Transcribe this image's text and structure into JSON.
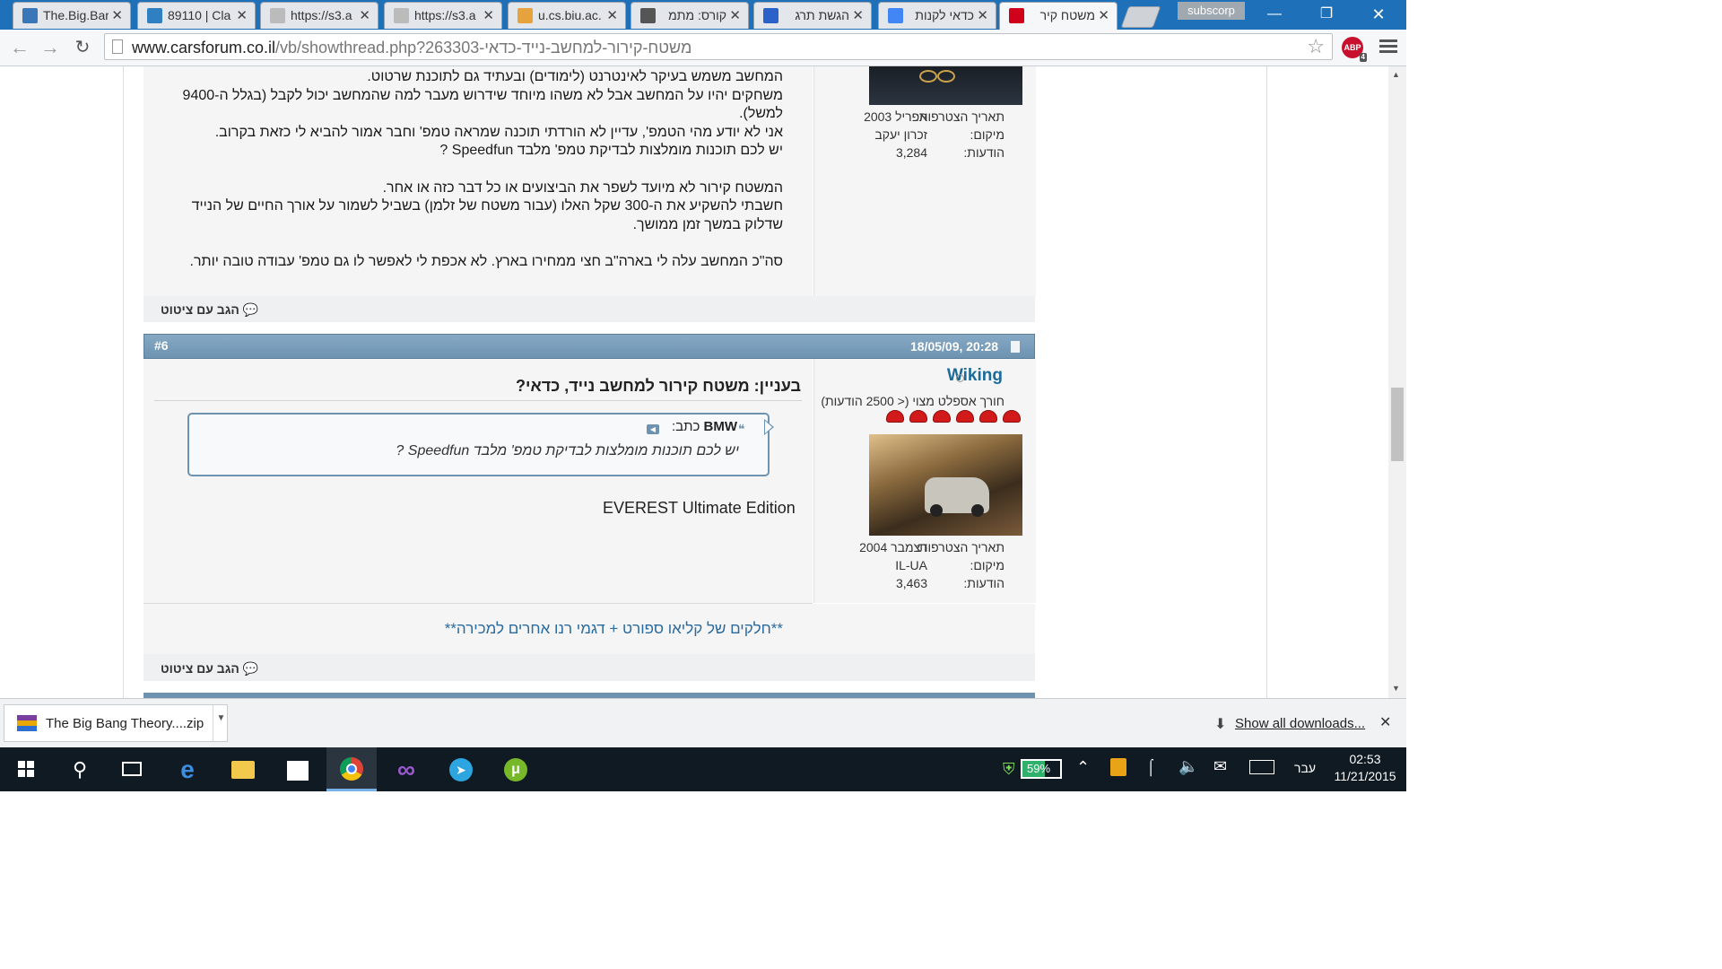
{
  "browser": {
    "tabs": [
      {
        "title": "The.Big.Bar",
        "favicon": "tz-icon",
        "color": "#3a77b8"
      },
      {
        "title": "89110 | Cla",
        "favicon": "p-icon",
        "color": "#2f7fc1"
      },
      {
        "title": "https://s3.a",
        "favicon": "page-icon",
        "color": "#bbbbbb"
      },
      {
        "title": "https://s3.a",
        "favicon": "page-icon",
        "color": "#bbbbbb"
      },
      {
        "title": "u.cs.biu.ac.",
        "favicon": "mail-icon",
        "color": "#e6a23c"
      },
      {
        "title": "קורס: מתמ",
        "favicon": "moodle-icon",
        "color": "#555555"
      },
      {
        "title": "הגשת תרג",
        "favicon": "bookmark-icon",
        "color": "#2b62c9"
      },
      {
        "title": "כדאי לקנות",
        "favicon": "google-icon",
        "color": "#4285f4"
      },
      {
        "title": "משטח קיר",
        "favicon": "car-icon",
        "color": "#d0021b",
        "active": true
      }
    ],
    "profile_label": "subscorp",
    "address": {
      "host": "www.carsforum.co.il",
      "path": "/vb/showthread.php?263303-משטח-קירור-למחשב-נייד-כדאי"
    },
    "abp_badge": "4"
  },
  "post_prev": {
    "lines": [
      "המחשב משמש בעיקר לאינטרנט (לימודים) ובעתיד גם לתוכנת שרטוט.",
      "משחקים יהיו על המחשב אבל לא משהו מיוחד שידרוש מעבר למה שהמחשב יכול לקבל (בגלל ה-9400",
      "למשל).",
      "אני לא יודע מהי הטמפ', עדיין לא הורדתי תוכנה שמראה טמפ' וחבר אמור להביא לי כזאת בקרוב.",
      "יש לכם תוכנות מומלצות לבדיקת טמפ' מלבד Speedfun ?",
      "",
      "המשטח קירור לא מיועד לשפר את הביצועים או כל דבר כזה או אחר.",
      "חשבתי להשקיע את ה-300 שקל האלו (עבור משטח של זלמן) בשביל לשמור על אורך החיים של הנייד",
      "שדלוק במשך זמן ממושך.",
      "",
      "סה\"כ המחשב עלה לי בארה\"ב חצי ממחירו בארץ. לא אכפת לי לאפשר לו גם טמפ' עבודה טובה יותר."
    ],
    "author_info": [
      {
        "label": "תאריך הצטרפות:",
        "value": "אפריל 2003"
      },
      {
        "label": "מיקום:",
        "value": "זכרון יעקב"
      },
      {
        "label": "הודעות:",
        "value": "3,284"
      }
    ],
    "reply_quote_label": "הגב עם ציטוט"
  },
  "post": {
    "number": "#6",
    "datetime": "18/05/09, 20:28",
    "author": "Wiking",
    "author_title": "חורך אספלט מצוי (< 2500 הודעות)",
    "reputation_count": 6,
    "title": "בעניין: משטח קירור למחשב נייד, כדאי?",
    "quote": {
      "author": "BMW",
      "wrote": "כתב:",
      "text": "יש לכם תוכנות מומלצות לבדיקת טמפ' מלבד Speedfun ?"
    },
    "body": "EVEREST Ultimate Edition",
    "signature": "**חלקים של קליאו ספורט + דגמי רנו אחרים למכירה**",
    "author_info": [
      {
        "label": "תאריך הצטרפות:",
        "value": "דצמבר 2004"
      },
      {
        "label": "מיקום:",
        "value": "IL-UA"
      },
      {
        "label": "הודעות:",
        "value": "3,463"
      }
    ],
    "reply_quote_label": "הגב עם ציטוט"
  },
  "downloads": {
    "file": "The Big Bang Theory....zip",
    "show_all": "Show all downloads..."
  },
  "taskbar": {
    "battery": "59%",
    "lang": "עבר",
    "time": "02:53",
    "date": "11/21/2015"
  },
  "colors": {
    "postbar": "#6d93b1",
    "accent": "#2a5c8a"
  }
}
